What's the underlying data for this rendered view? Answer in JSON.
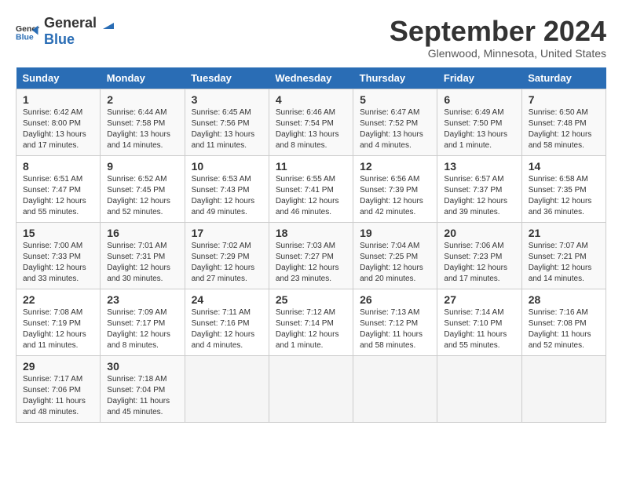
{
  "logo": {
    "general": "General",
    "blue": "Blue"
  },
  "title": "September 2024",
  "location": "Glenwood, Minnesota, United States",
  "days_of_week": [
    "Sunday",
    "Monday",
    "Tuesday",
    "Wednesday",
    "Thursday",
    "Friday",
    "Saturday"
  ],
  "weeks": [
    [
      {
        "day": "1",
        "sunrise": "6:42 AM",
        "sunset": "8:00 PM",
        "daylight": "13 hours and 17 minutes."
      },
      {
        "day": "2",
        "sunrise": "6:44 AM",
        "sunset": "7:58 PM",
        "daylight": "13 hours and 14 minutes."
      },
      {
        "day": "3",
        "sunrise": "6:45 AM",
        "sunset": "7:56 PM",
        "daylight": "13 hours and 11 minutes."
      },
      {
        "day": "4",
        "sunrise": "6:46 AM",
        "sunset": "7:54 PM",
        "daylight": "13 hours and 8 minutes."
      },
      {
        "day": "5",
        "sunrise": "6:47 AM",
        "sunset": "7:52 PM",
        "daylight": "13 hours and 4 minutes."
      },
      {
        "day": "6",
        "sunrise": "6:49 AM",
        "sunset": "7:50 PM",
        "daylight": "13 hours and 1 minute."
      },
      {
        "day": "7",
        "sunrise": "6:50 AM",
        "sunset": "7:48 PM",
        "daylight": "12 hours and 58 minutes."
      }
    ],
    [
      {
        "day": "8",
        "sunrise": "6:51 AM",
        "sunset": "7:47 PM",
        "daylight": "12 hours and 55 minutes."
      },
      {
        "day": "9",
        "sunrise": "6:52 AM",
        "sunset": "7:45 PM",
        "daylight": "12 hours and 52 minutes."
      },
      {
        "day": "10",
        "sunrise": "6:53 AM",
        "sunset": "7:43 PM",
        "daylight": "12 hours and 49 minutes."
      },
      {
        "day": "11",
        "sunrise": "6:55 AM",
        "sunset": "7:41 PM",
        "daylight": "12 hours and 46 minutes."
      },
      {
        "day": "12",
        "sunrise": "6:56 AM",
        "sunset": "7:39 PM",
        "daylight": "12 hours and 42 minutes."
      },
      {
        "day": "13",
        "sunrise": "6:57 AM",
        "sunset": "7:37 PM",
        "daylight": "12 hours and 39 minutes."
      },
      {
        "day": "14",
        "sunrise": "6:58 AM",
        "sunset": "7:35 PM",
        "daylight": "12 hours and 36 minutes."
      }
    ],
    [
      {
        "day": "15",
        "sunrise": "7:00 AM",
        "sunset": "7:33 PM",
        "daylight": "12 hours and 33 minutes."
      },
      {
        "day": "16",
        "sunrise": "7:01 AM",
        "sunset": "7:31 PM",
        "daylight": "12 hours and 30 minutes."
      },
      {
        "day": "17",
        "sunrise": "7:02 AM",
        "sunset": "7:29 PM",
        "daylight": "12 hours and 27 minutes."
      },
      {
        "day": "18",
        "sunrise": "7:03 AM",
        "sunset": "7:27 PM",
        "daylight": "12 hours and 23 minutes."
      },
      {
        "day": "19",
        "sunrise": "7:04 AM",
        "sunset": "7:25 PM",
        "daylight": "12 hours and 20 minutes."
      },
      {
        "day": "20",
        "sunrise": "7:06 AM",
        "sunset": "7:23 PM",
        "daylight": "12 hours and 17 minutes."
      },
      {
        "day": "21",
        "sunrise": "7:07 AM",
        "sunset": "7:21 PM",
        "daylight": "12 hours and 14 minutes."
      }
    ],
    [
      {
        "day": "22",
        "sunrise": "7:08 AM",
        "sunset": "7:19 PM",
        "daylight": "12 hours and 11 minutes."
      },
      {
        "day": "23",
        "sunrise": "7:09 AM",
        "sunset": "7:17 PM",
        "daylight": "12 hours and 8 minutes."
      },
      {
        "day": "24",
        "sunrise": "7:11 AM",
        "sunset": "7:16 PM",
        "daylight": "12 hours and 4 minutes."
      },
      {
        "day": "25",
        "sunrise": "7:12 AM",
        "sunset": "7:14 PM",
        "daylight": "12 hours and 1 minute."
      },
      {
        "day": "26",
        "sunrise": "7:13 AM",
        "sunset": "7:12 PM",
        "daylight": "11 hours and 58 minutes."
      },
      {
        "day": "27",
        "sunrise": "7:14 AM",
        "sunset": "7:10 PM",
        "daylight": "11 hours and 55 minutes."
      },
      {
        "day": "28",
        "sunrise": "7:16 AM",
        "sunset": "7:08 PM",
        "daylight": "11 hours and 52 minutes."
      }
    ],
    [
      {
        "day": "29",
        "sunrise": "7:17 AM",
        "sunset": "7:06 PM",
        "daylight": "11 hours and 48 minutes."
      },
      {
        "day": "30",
        "sunrise": "7:18 AM",
        "sunset": "7:04 PM",
        "daylight": "11 hours and 45 minutes."
      },
      null,
      null,
      null,
      null,
      null
    ]
  ]
}
